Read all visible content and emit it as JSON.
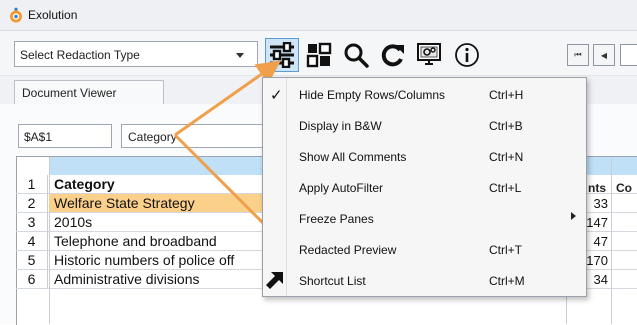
{
  "window": {
    "title": "Exolution"
  },
  "toolbar": {
    "redaction_select": "Select Redaction Type",
    "buttons": [
      {
        "icon": "sliders-icon",
        "name": "settings-sliders-button"
      },
      {
        "icon": "layout-grid-icon",
        "name": "layout-button"
      },
      {
        "icon": "search-icon",
        "name": "search-button"
      },
      {
        "icon": "refresh-icon",
        "name": "refresh-button"
      },
      {
        "icon": "monitor-gear-icon",
        "name": "screen-settings-button"
      },
      {
        "icon": "info-icon",
        "name": "info-button"
      }
    ],
    "nav": {
      "first_symbol": "⏮",
      "prev_symbol": "◀"
    }
  },
  "tab": {
    "label": "Document Viewer"
  },
  "formula_bar": {
    "cell_ref": "$A$1",
    "value": "Category"
  },
  "grid": {
    "header_partials": [
      "nts",
      "Co"
    ],
    "rows": [
      {
        "num": "1",
        "text": "Category",
        "bold": true,
        "value": ""
      },
      {
        "num": "2",
        "text": "Welfare State Strategy",
        "highlight": true,
        "value": "33"
      },
      {
        "num": "3",
        "text": "2010s",
        "value": "147"
      },
      {
        "num": "4",
        "text": "Telephone and broadband",
        "value": "47"
      },
      {
        "num": "5",
        "text": "Historic numbers of police off",
        "value": "170"
      },
      {
        "num": "6",
        "text": "Administrative divisions",
        "value": "34"
      }
    ],
    "colors": {
      "header_blue": "#bfe0f6",
      "highlight_orange": "#fbd08a"
    }
  },
  "menu": {
    "items": [
      {
        "label": "Hide Empty Rows/Columns",
        "shortcut": "Ctrl+H",
        "checked": true
      },
      {
        "label": "Display in B&W",
        "shortcut": "Ctrl+B"
      },
      {
        "label": "Show All Comments",
        "shortcut": "Ctrl+N"
      },
      {
        "label": "Apply AutoFilter",
        "shortcut": "Ctrl+L"
      },
      {
        "label": "Freeze Panes",
        "shortcut": "",
        "submenu": true
      },
      {
        "label": "Redacted Preview",
        "shortcut": "Ctrl+T"
      },
      {
        "label": "Shortcut List",
        "shortcut": "Ctrl+M",
        "icon": "shortcut-arrow-icon"
      }
    ],
    "checkmark": "✓"
  },
  "annotation_color": "#f0a04b"
}
